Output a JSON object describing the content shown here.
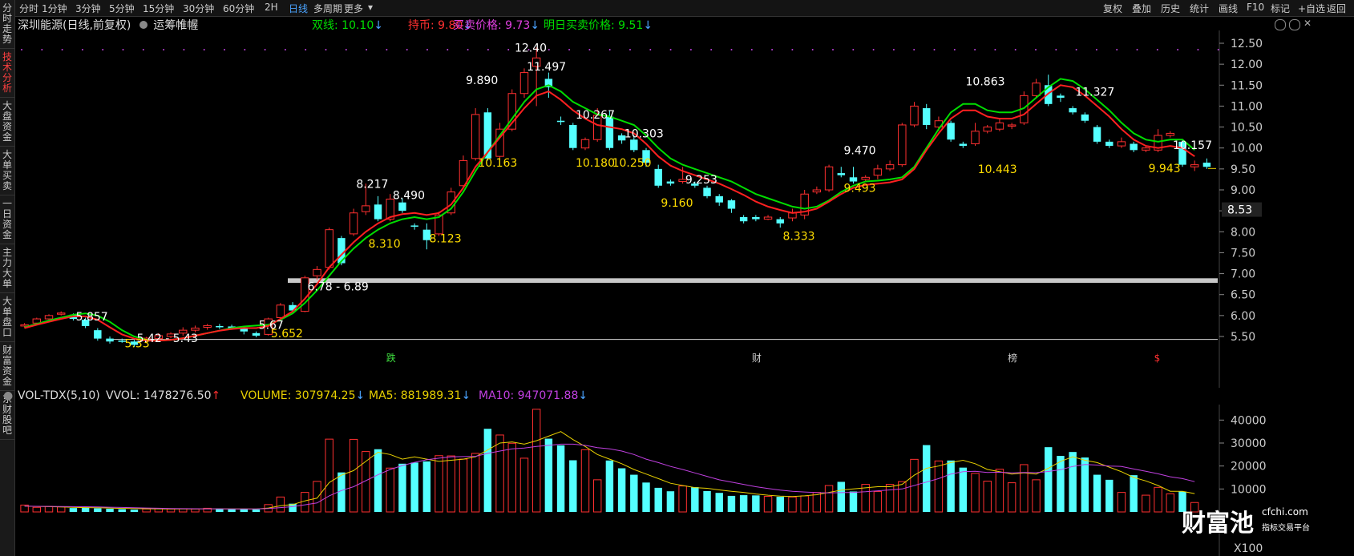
{
  "sidebar": {
    "items": [
      {
        "label": "分时走势",
        "active": false
      },
      {
        "label": "技术分析",
        "active": true
      },
      {
        "label": "大盘资金",
        "active": false
      },
      {
        "label": "大单买卖",
        "active": false
      },
      {
        "label": "一日资金",
        "active": false
      },
      {
        "label": "主力大单",
        "active": false
      },
      {
        "label": "大单盘口",
        "active": false
      },
      {
        "label": "财富资金",
        "active": false
      },
      {
        "label": "东财股吧",
        "active": false
      }
    ]
  },
  "toolbar": {
    "periods": [
      "分时",
      "1分钟",
      "3分钟",
      "5分钟",
      "15分钟",
      "30分钟",
      "60分钟",
      "2H",
      "日线",
      "多周期",
      "更多"
    ],
    "active_period": "日线",
    "right_buttons": [
      "复权",
      "叠加",
      "历史",
      "统计",
      "画线",
      "F10",
      "标记",
      "+自选",
      "返回"
    ]
  },
  "header": {
    "stock_title": "深圳能源(日线,前复权)",
    "indicator_name": "运筹帷幄",
    "indicators": [
      {
        "text": "双线: 10.10",
        "arrow": "↓",
        "color": "#00dd00"
      },
      {
        "text": "持币: 9.80",
        "arrow": "↓",
        "color": "#ff3030"
      },
      {
        "text": "买卖价格: 9.73",
        "arrow": "↓",
        "color": "#e040e0"
      },
      {
        "text": "明日买卖价格: 9.51",
        "arrow": "↓",
        "color": "#00dd00"
      }
    ]
  },
  "volume_header": {
    "name": "VOL-TDX(5,10)",
    "vvol": "VVOL: 1478276.50",
    "vvol_arrow": "↑",
    "volume": "VOLUME: 307974.25",
    "volume_arrow": "↓",
    "ma5": "MA5: 881989.31",
    "ma5_arrow": "↓",
    "ma10": "MA10: 947071.88",
    "ma10_arrow": "↓"
  },
  "colors": {
    "up": "#ff3030",
    "down": "#54ffff",
    "buy_line": "#00dd00",
    "sell_line": "#ff2020",
    "ma5": "#e8d000",
    "ma10": "#c040e0",
    "label_white": "#ffffff",
    "label_yellow": "#ffdd00"
  },
  "chart_data": {
    "type": "candlestick",
    "price_axis": {
      "ticks": [
        "12.50",
        "12.00",
        "11.50",
        "11.00",
        "10.50",
        "10.00",
        "9.50",
        "9.00",
        "8.50",
        "8.00",
        "7.50",
        "7.00",
        "6.50",
        "6.00",
        "5.50"
      ],
      "range": [
        5.2,
        12.7
      ]
    },
    "current_price": "8.53",
    "support_band": {
      "low": 6.78,
      "high": 6.89,
      "label": "6.78 - 6.89"
    },
    "candles": [
      [
        5.75,
        5.78,
        5.7,
        5.82
      ],
      [
        5.82,
        5.92,
        5.78,
        5.95
      ],
      [
        5.92,
        6.0,
        5.88,
        6.03
      ],
      [
        6.05,
        6.06,
        6.0,
        6.1
      ],
      [
        6.02,
        5.92,
        5.88,
        6.05
      ],
      [
        5.9,
        5.75,
        5.7,
        5.95
      ],
      [
        5.65,
        5.45,
        5.4,
        5.7
      ],
      [
        5.45,
        5.38,
        5.33,
        5.5
      ],
      [
        5.4,
        5.38,
        5.35,
        5.45
      ],
      [
        5.38,
        5.3,
        5.25,
        5.42
      ],
      [
        5.4,
        5.46,
        5.36,
        5.49
      ],
      [
        5.45,
        5.52,
        5.4,
        5.58
      ],
      [
        5.5,
        5.56,
        5.46,
        5.6
      ],
      [
        5.58,
        5.65,
        5.52,
        5.72
      ],
      [
        5.65,
        5.7,
        5.6,
        5.76
      ],
      [
        5.72,
        5.76,
        5.66,
        5.8
      ],
      [
        5.75,
        5.72,
        5.68,
        5.8
      ],
      [
        5.74,
        5.7,
        5.66,
        5.78
      ],
      [
        5.7,
        5.62,
        5.55,
        5.74
      ],
      [
        5.58,
        5.52,
        5.48,
        5.62
      ],
      [
        5.55,
        5.92,
        5.52,
        5.95
      ],
      [
        5.95,
        6.25,
        5.92,
        6.3
      ],
      [
        6.25,
        6.12,
        6.08,
        6.32
      ],
      [
        6.1,
        6.9,
        6.08,
        6.95
      ],
      [
        6.95,
        7.1,
        6.85,
        7.18
      ],
      [
        7.15,
        8.05,
        7.1,
        8.1
      ],
      [
        7.85,
        7.25,
        7.2,
        7.9
      ],
      [
        7.95,
        8.45,
        7.9,
        8.55
      ],
      [
        8.48,
        8.62,
        8.4,
        9.15
      ],
      [
        8.65,
        8.3,
        8.25,
        8.85
      ],
      [
        8.3,
        8.78,
        8.25,
        8.9
      ],
      [
        8.7,
        8.5,
        8.45,
        8.8
      ],
      [
        8.15,
        8.13,
        8.05,
        8.2
      ],
      [
        8.05,
        7.8,
        7.58,
        8.2
      ],
      [
        7.95,
        8.4,
        7.9,
        8.48
      ],
      [
        8.45,
        8.95,
        8.4,
        9.05
      ],
      [
        9.1,
        9.7,
        9.05,
        9.82
      ],
      [
        9.75,
        10.8,
        9.7,
        10.95
      ],
      [
        10.85,
        9.75,
        9.7,
        10.95
      ],
      [
        9.8,
        10.45,
        9.7,
        10.6
      ],
      [
        10.45,
        11.3,
        10.4,
        11.4
      ],
      [
        11.3,
        11.8,
        11.2,
        11.9
      ],
      [
        11.95,
        12.15,
        11.0,
        12.4
      ],
      [
        11.65,
        11.45,
        11.2,
        11.8
      ],
      [
        10.65,
        10.62,
        10.55,
        10.75
      ],
      [
        10.55,
        10.0,
        9.95,
        10.6
      ],
      [
        10.0,
        10.2,
        9.95,
        10.25
      ],
      [
        10.2,
        10.78,
        10.15,
        10.95
      ],
      [
        10.75,
        10.0,
        9.95,
        10.9
      ],
      [
        10.3,
        10.18,
        10.1,
        10.35
      ],
      [
        10.2,
        9.95,
        9.9,
        10.3
      ],
      [
        9.95,
        9.65,
        9.55,
        10.0
      ],
      [
        9.5,
        9.1,
        9.05,
        9.6
      ],
      [
        9.2,
        9.15,
        9.1,
        9.25
      ],
      [
        9.2,
        9.25,
        9.15,
        9.55
      ],
      [
        9.15,
        9.1,
        9.05,
        9.2
      ],
      [
        9.05,
        8.85,
        8.8,
        9.1
      ],
      [
        8.85,
        8.7,
        8.62,
        8.9
      ],
      [
        8.75,
        8.55,
        8.45,
        8.78
      ],
      [
        8.35,
        8.25,
        8.2,
        8.4
      ],
      [
        8.35,
        8.3,
        8.25,
        8.4
      ],
      [
        8.3,
        8.35,
        8.28,
        8.4
      ],
      [
        8.3,
        8.2,
        8.1,
        8.35
      ],
      [
        8.33,
        8.45,
        8.25,
        8.55
      ],
      [
        8.4,
        8.9,
        8.3,
        9.0
      ],
      [
        8.95,
        9.0,
        8.9,
        9.08
      ],
      [
        9.0,
        9.55,
        8.95,
        9.6
      ],
      [
        9.4,
        9.35,
        9.3,
        9.55
      ],
      [
        9.3,
        9.2,
        9.15,
        9.55
      ],
      [
        9.25,
        9.3,
        9.2,
        9.35
      ],
      [
        9.35,
        9.5,
        9.25,
        9.6
      ],
      [
        9.5,
        9.6,
        9.45,
        9.7
      ],
      [
        9.6,
        10.55,
        9.55,
        10.6
      ],
      [
        10.55,
        11.0,
        10.5,
        11.1
      ],
      [
        10.95,
        10.55,
        10.45,
        11.05
      ],
      [
        10.5,
        10.65,
        10.4,
        10.75
      ],
      [
        10.6,
        10.2,
        10.15,
        10.65
      ],
      [
        10.1,
        10.05,
        10.0,
        10.15
      ],
      [
        10.1,
        10.4,
        10.05,
        10.6
      ],
      [
        10.4,
        10.5,
        10.35,
        10.55
      ],
      [
        10.45,
        10.6,
        10.4,
        10.7
      ],
      [
        10.55,
        10.55,
        10.45,
        10.6
      ],
      [
        10.6,
        11.25,
        10.55,
        11.35
      ],
      [
        11.25,
        11.55,
        11.2,
        11.65
      ],
      [
        11.5,
        11.05,
        11.0,
        11.75
      ],
      [
        11.25,
        11.2,
        11.1,
        11.3
      ],
      [
        10.95,
        10.85,
        10.8,
        11.0
      ],
      [
        10.8,
        10.65,
        10.6,
        10.85
      ],
      [
        10.5,
        10.15,
        10.1,
        10.55
      ],
      [
        10.15,
        10.05,
        10.0,
        10.2
      ],
      [
        10.05,
        10.15,
        10.0,
        10.25
      ],
      [
        10.1,
        9.95,
        9.9,
        10.15
      ],
      [
        9.95,
        10.0,
        9.9,
        10.05
      ],
      [
        9.95,
        10.3,
        9.9,
        10.45
      ],
      [
        10.3,
        10.35,
        10.25,
        10.4
      ],
      [
        10.15,
        9.6,
        9.55,
        10.2
      ],
      [
        9.55,
        9.6,
        9.45,
        9.7
      ],
      [
        9.65,
        9.55,
        9.5,
        9.75
      ]
    ],
    "volume_axis": {
      "ticks": [
        "40000",
        "30000",
        "20000",
        "10000"
      ],
      "unit": "X100",
      "range": [
        0,
        46000
      ]
    },
    "volumes": [
      3000,
      2000,
      2400,
      2200,
      1700,
      2000,
      1600,
      1400,
      1200,
      1000,
      1300,
      1500,
      1300,
      1400,
      1300,
      1600,
      1400,
      1200,
      1300,
      1100,
      3200,
      6500,
      3600,
      8500,
      13300,
      31700,
      17200,
      31600,
      26300,
      27300,
      19100,
      21000,
      21500,
      22000,
      24500,
      24400,
      23000,
      25500,
      36200,
      33500,
      29900,
      23400,
      44700,
      31900,
      29000,
      22500,
      27100,
      14000,
      22400,
      19000,
      16200,
      12800,
      10500,
      9000,
      11300,
      10800,
      9100,
      8300,
      7000,
      7300,
      7200,
      6800,
      6600,
      6500,
      7000,
      8500,
      11500,
      13100,
      8900,
      12000,
      8900,
      12000,
      13200,
      22900,
      29100,
      22200,
      22400,
      19300,
      16800,
      13400,
      18600,
      12700,
      20600,
      14000,
      28200,
      24400,
      26100,
      23700,
      16200,
      14000,
      8500,
      16000,
      7300,
      10700,
      7900,
      8900,
      4100
    ],
    "ma5": [
      2500,
      2400,
      2300,
      2200,
      2000,
      1900,
      1800,
      1700,
      1550,
      1450,
      1380,
      1350,
      1320,
      1300,
      1340,
      1350,
      1360,
      1340,
      1320,
      1250,
      1700,
      2700,
      3200,
      4800,
      6000,
      12800,
      16000,
      18000,
      22000,
      26000,
      25000,
      23000,
      24000,
      23000,
      22000,
      22500,
      23000,
      24000,
      27000,
      30000,
      30500,
      29500,
      31000,
      33000,
      35000,
      31500,
      28500,
      25000,
      23000,
      21000,
      18500,
      16500,
      14500,
      12500,
      11500,
      10600,
      10300,
      9600,
      9000,
      8500,
      7800,
      7300,
      6900,
      6700,
      7000,
      7500,
      8500,
      9500,
      10000,
      10500,
      11000,
      11000,
      12000,
      16000,
      19000,
      20000,
      21500,
      22500,
      21000,
      18500,
      17500,
      16500,
      17000,
      16500,
      19000,
      22000,
      24000,
      22500,
      21500,
      19500,
      17500,
      15000,
      13500,
      11500,
      9000,
      9000,
      8000
    ],
    "ma10": [
      2500,
      2450,
      2400,
      2350,
      2300,
      2250,
      2150,
      2050,
      1950,
      1850,
      1700,
      1600,
      1500,
      1420,
      1380,
      1360,
      1350,
      1340,
      1330,
      1300,
      1450,
      1900,
      2300,
      3100,
      3900,
      7000,
      9300,
      11000,
      13600,
      16200,
      18500,
      20200,
      21600,
      22700,
      23400,
      24000,
      24100,
      24200,
      25500,
      26500,
      27500,
      27800,
      28500,
      29000,
      29500,
      29500,
      29000,
      28000,
      27500,
      26500,
      25000,
      23000,
      21500,
      19800,
      18500,
      17000,
      15500,
      14000,
      13000,
      12000,
      11000,
      10200,
      9500,
      9000,
      8700,
      8400,
      8300,
      8400,
      8500,
      8800,
      9200,
      9600,
      10000,
      11500,
      13000,
      14500,
      16500,
      17500,
      17700,
      17200,
      17300,
      17000,
      17200,
      17100,
      17600,
      18400,
      19800,
      20700,
      20400,
      20000,
      19800,
      18700,
      17700,
      16600,
      15300,
      14500,
      13200
    ],
    "buy_line": [
      5.72,
      5.8,
      5.88,
      5.95,
      6.02,
      6.05,
      6.0,
      5.85,
      5.65,
      5.5,
      5.42,
      5.4,
      5.42,
      5.46,
      5.52,
      5.58,
      5.64,
      5.7,
      5.74,
      5.76,
      5.78,
      5.9,
      6.05,
      6.3,
      6.6,
      6.95,
      7.3,
      7.6,
      7.85,
      8.05,
      8.2,
      8.3,
      8.35,
      8.3,
      8.35,
      8.55,
      8.95,
      9.45,
      9.9,
      10.3,
      10.7,
      11.1,
      11.4,
      11.5,
      11.35,
      11.1,
      10.95,
      10.8,
      10.75,
      10.65,
      10.55,
      10.3,
      10.0,
      9.75,
      9.6,
      9.5,
      9.4,
      9.3,
      9.2,
      9.05,
      8.9,
      8.8,
      8.7,
      8.6,
      8.55,
      8.6,
      8.75,
      8.95,
      9.1,
      9.2,
      9.22,
      9.25,
      9.3,
      9.55,
      10.0,
      10.45,
      10.85,
      11.05,
      11.05,
      10.9,
      10.85,
      10.85,
      10.95,
      11.2,
      11.45,
      11.65,
      11.6,
      11.4,
      11.15,
      10.9,
      10.6,
      10.35,
      10.2,
      10.15,
      10.2,
      10.2,
      9.95
    ],
    "sell_line": [
      5.7,
      5.78,
      5.85,
      5.92,
      5.98,
      5.98,
      5.9,
      5.72,
      5.55,
      5.45,
      5.4,
      5.4,
      5.42,
      5.46,
      5.52,
      5.58,
      5.64,
      5.68,
      5.7,
      5.7,
      5.75,
      5.92,
      6.1,
      6.4,
      6.75,
      7.15,
      7.45,
      7.75,
      8.0,
      8.2,
      8.35,
      8.42,
      8.45,
      8.4,
      8.45,
      8.65,
      9.05,
      9.55,
      9.9,
      10.25,
      10.6,
      10.95,
      11.25,
      11.35,
      11.15,
      10.9,
      10.7,
      10.55,
      10.5,
      10.45,
      10.35,
      10.1,
      9.8,
      9.58,
      9.45,
      9.35,
      9.25,
      9.15,
      9.02,
      8.88,
      8.72,
      8.6,
      8.52,
      8.45,
      8.48,
      8.55,
      8.72,
      8.9,
      9.05,
      9.12,
      9.15,
      9.18,
      9.25,
      9.5,
      9.95,
      10.35,
      10.7,
      10.9,
      10.9,
      10.75,
      10.7,
      10.7,
      10.8,
      11.05,
      11.3,
      11.5,
      11.45,
      11.25,
      11.0,
      10.75,
      10.45,
      10.2,
      10.05,
      10.0,
      10.05,
      10.0,
      9.8
    ],
    "annotations": [
      {
        "i": 5,
        "price": 5.88,
        "text": "5.857",
        "color": "white"
      },
      {
        "i": 9,
        "price": 5.24,
        "text": "5.33",
        "color": "yellow"
      },
      {
        "i": 10,
        "price": 5.37,
        "text": "5.42 - 5.43",
        "color": "white"
      },
      {
        "i": 20,
        "price": 5.68,
        "text": "5.67",
        "color": "white"
      },
      {
        "i": 21,
        "price": 5.48,
        "text": "5.652",
        "color": "yellow"
      },
      {
        "i": 24,
        "price": 6.6,
        "text": "6.78 - 6.89",
        "color": "white"
      },
      {
        "i": 28,
        "price": 9.05,
        "text": "8.217",
        "color": "white"
      },
      {
        "i": 29,
        "price": 7.62,
        "text": "8.310",
        "color": "yellow"
      },
      {
        "i": 31,
        "price": 8.78,
        "text": "8.490",
        "color": "white"
      },
      {
        "i": 34,
        "price": 7.75,
        "text": "8.123",
        "color": "yellow"
      },
      {
        "i": 37,
        "price": 11.52,
        "text": "9.890",
        "color": "white"
      },
      {
        "i": 38,
        "price": 9.55,
        "text": "10.163",
        "color": "yellow"
      },
      {
        "i": 41,
        "price": 12.3,
        "text": "12.40",
        "color": "white"
      },
      {
        "i": 42,
        "price": 11.85,
        "text": "11.497",
        "color": "white"
      },
      {
        "i": 46,
        "price": 10.7,
        "text": "10.267",
        "color": "white"
      },
      {
        "i": 46,
        "price": 9.55,
        "text": "10.180",
        "color": "yellow"
      },
      {
        "i": 49,
        "price": 9.55,
        "text": "10.250",
        "color": "yellow"
      },
      {
        "i": 50,
        "price": 10.25,
        "text": "10.303",
        "color": "white"
      },
      {
        "i": 55,
        "price": 9.15,
        "text": "9.253",
        "color": "white"
      },
      {
        "i": 53,
        "price": 8.6,
        "text": "9.160",
        "color": "yellow"
      },
      {
        "i": 63,
        "price": 7.8,
        "text": "8.333",
        "color": "yellow"
      },
      {
        "i": 68,
        "price": 9.85,
        "text": "9.470",
        "color": "white"
      },
      {
        "i": 68,
        "price": 8.95,
        "text": "9.493",
        "color": "yellow"
      },
      {
        "i": 78,
        "price": 11.5,
        "text": "10.863",
        "color": "white"
      },
      {
        "i": 79,
        "price": 9.4,
        "text": "10.443",
        "color": "yellow"
      },
      {
        "i": 87,
        "price": 11.25,
        "text": "11.327",
        "color": "white"
      },
      {
        "i": 93,
        "price": 9.42,
        "text": "9.943",
        "color": "yellow"
      },
      {
        "i": 95,
        "price": 9.98,
        "text": "10.157",
        "color": "white"
      }
    ],
    "event_markers": [
      {
        "i": 30,
        "text": "跌"
      },
      {
        "i": 60,
        "text": "财"
      },
      {
        "i": 81,
        "text": "榜"
      },
      {
        "i": 93,
        "text": "$"
      }
    ]
  },
  "watermark": {
    "brand": "财富池",
    "site": "cfchi.com",
    "slogan": "指标交易平台"
  }
}
